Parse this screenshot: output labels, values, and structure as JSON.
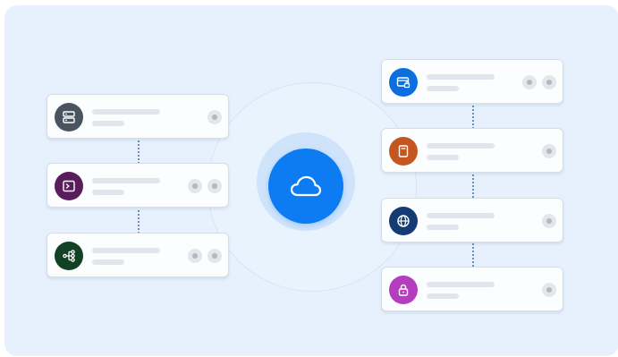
{
  "diagram": {
    "hub": {
      "icon": "cloud-icon",
      "color": "#0d7cf2"
    },
    "left_cards": [
      {
        "icon": "server-icon",
        "color": "#4a5460",
        "dots": 1
      },
      {
        "icon": "terminal-icon",
        "color": "#5a1d5c",
        "dots": 2
      },
      {
        "icon": "network-tree-icon",
        "color": "#124225",
        "dots": 2
      }
    ],
    "right_cards": [
      {
        "icon": "lock-card-icon",
        "color": "#0b6fe0",
        "dots": 2
      },
      {
        "icon": "file-icon",
        "color": "#c4571f",
        "dots": 1
      },
      {
        "icon": "globe-icon",
        "color": "#123c73",
        "dots": 1
      },
      {
        "icon": "padlock-icon",
        "color": "#b43cbf",
        "dots": 1
      }
    ]
  }
}
